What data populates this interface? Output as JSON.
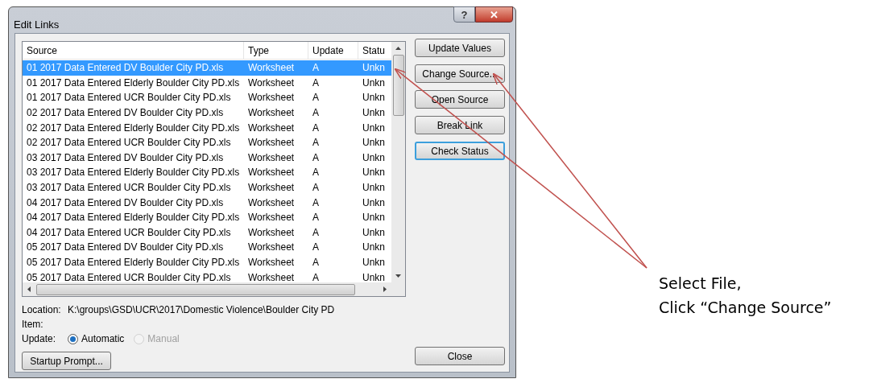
{
  "window": {
    "title": "Edit Links",
    "controls": [
      "?",
      "✕"
    ]
  },
  "table": {
    "columns": [
      "Source",
      "Type",
      "Update",
      "Statu"
    ],
    "rows": [
      {
        "source": "01 2017 Data Entered DV Boulder City PD.xls",
        "type": "Worksheet",
        "update": "A",
        "status": "Unkn",
        "selected": true
      },
      {
        "source": "01 2017 Data Entered Elderly Boulder City PD.xls",
        "type": "Worksheet",
        "update": "A",
        "status": "Unkn",
        "selected": false
      },
      {
        "source": "01 2017 Data Entered UCR Boulder City PD.xls",
        "type": "Worksheet",
        "update": "A",
        "status": "Unkn",
        "selected": false
      },
      {
        "source": "02 2017 Data Entered DV Boulder City PD.xls",
        "type": "Worksheet",
        "update": "A",
        "status": "Unkn",
        "selected": false
      },
      {
        "source": "02 2017 Data Entered Elderly Boulder City PD.xls",
        "type": "Worksheet",
        "update": "A",
        "status": "Unkn",
        "selected": false
      },
      {
        "source": "02 2017 Data Entered UCR Boulder City PD.xls",
        "type": "Worksheet",
        "update": "A",
        "status": "Unkn",
        "selected": false
      },
      {
        "source": "03 2017 Data Entered DV Boulder City PD.xls",
        "type": "Worksheet",
        "update": "A",
        "status": "Unkn",
        "selected": false
      },
      {
        "source": "03 2017 Data Entered Elderly Boulder City PD.xls",
        "type": "Worksheet",
        "update": "A",
        "status": "Unkn",
        "selected": false
      },
      {
        "source": "03 2017 Data Entered UCR Boulder City PD.xls",
        "type": "Worksheet",
        "update": "A",
        "status": "Unkn",
        "selected": false
      },
      {
        "source": "04 2017 Data Entered DV Boulder City PD.xls",
        "type": "Worksheet",
        "update": "A",
        "status": "Unkn",
        "selected": false
      },
      {
        "source": "04 2017 Data Entered Elderly Boulder City PD.xls",
        "type": "Worksheet",
        "update": "A",
        "status": "Unkn",
        "selected": false
      },
      {
        "source": "04 2017 Data Entered UCR Boulder City PD.xls",
        "type": "Worksheet",
        "update": "A",
        "status": "Unkn",
        "selected": false
      },
      {
        "source": "05 2017 Data Entered DV Boulder City PD.xls",
        "type": "Worksheet",
        "update": "A",
        "status": "Unkn",
        "selected": false
      },
      {
        "source": "05 2017 Data Entered Elderly Boulder City PD.xls",
        "type": "Worksheet",
        "update": "A",
        "status": "Unkn",
        "selected": false
      },
      {
        "source": "05 2017 Data Entered UCR Boulder City PD.xls",
        "type": "Worksheet",
        "update": "A",
        "status": "Unkn",
        "selected": false
      }
    ]
  },
  "side_buttons": [
    {
      "label": "Update Values",
      "focused": false
    },
    {
      "label": "Change Source...",
      "focused": false
    },
    {
      "label": "Open Source",
      "focused": false
    },
    {
      "label": "Break Link",
      "focused": false
    },
    {
      "label": "Check Status",
      "focused": true
    }
  ],
  "location": {
    "label": "Location:",
    "value": "K:\\groups\\GSD\\UCR\\2017\\Domestic Violence\\Boulder City PD"
  },
  "item": {
    "label": "Item:"
  },
  "update": {
    "label": "Update:",
    "options": [
      {
        "label": "Automatic",
        "selected": true,
        "disabled": false
      },
      {
        "label": "Manual",
        "selected": false,
        "disabled": true
      }
    ]
  },
  "bottom_buttons": [
    "Startup Prompt...",
    "Close"
  ],
  "annotation": {
    "lines": [
      "Select File,",
      "Click “Change Source”"
    ]
  }
}
